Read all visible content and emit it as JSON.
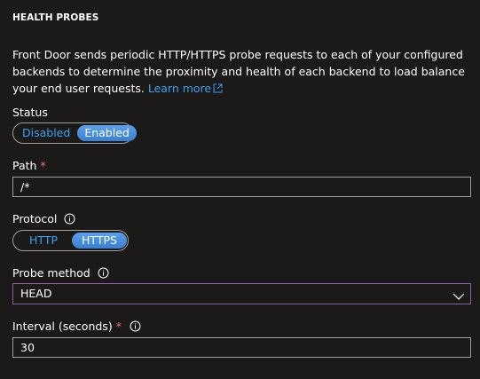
{
  "section": {
    "title": "HEALTH PROBES",
    "description": "Front Door sends periodic HTTP/HTTPS probe requests to each of your configured backends to determine the proximity and health of each backend to load balance your end user requests.",
    "learn_more": "Learn more"
  },
  "status": {
    "label": "Status",
    "options": [
      "Disabled",
      "Enabled"
    ],
    "selected": "Enabled"
  },
  "path": {
    "label": "Path",
    "required_mark": "*",
    "value": "/*"
  },
  "protocol": {
    "label": "Protocol",
    "options": [
      "HTTP",
      "HTTPS"
    ],
    "selected": "HTTPS"
  },
  "probe_method": {
    "label": "Probe method",
    "value": "HEAD"
  },
  "interval": {
    "label": "Interval (seconds)",
    "required_mark": "*",
    "value": "30"
  },
  "colors": {
    "link": "#3aa0f3",
    "required": "#f1707b",
    "toggle_selected": "#3a8ae0",
    "select_border": "#8c5fb5"
  }
}
